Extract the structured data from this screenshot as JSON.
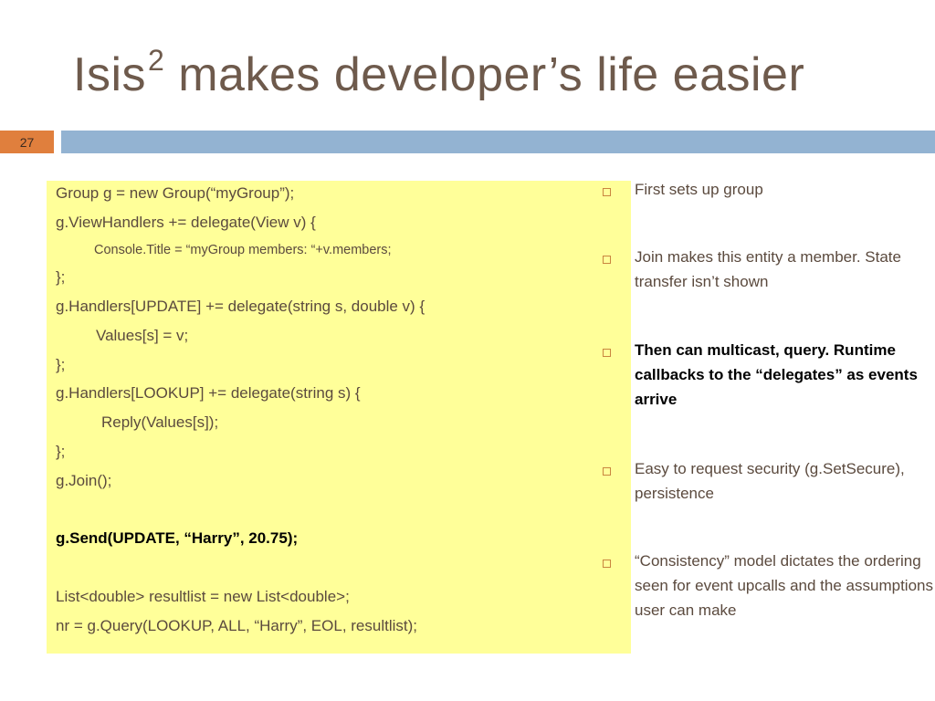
{
  "slide": {
    "title_main": "Isis",
    "title_sup": "2",
    "title_rest": " makes developer’s life easier",
    "number": "27"
  },
  "code_lines": [
    "Group g = new Group(“myGroup”);",
    "g.ViewHandlers += delegate(View v) {",
    "Console.Title = “myGroup members: “+v.members;",
    "};",
    "g.Handlers[UPDATE] += delegate(string s, double v) {",
    "Values[s] = v;",
    "};",
    "g.Handlers[LOOKUP] += delegate(string s) {",
    "Reply(Values[s]);",
    "};",
    "g.Join();",
    "g.Send(UPDATE, “Harry”, 20.75);",
    "List<double> resultlist = new List<double>;",
    "nr = g.Query(LOOKUP, ALL, “Harry”, EOL, resultlist);"
  ],
  "bullets": [
    "First sets up group",
    "Join makes this entity a member. State transfer isn’t shown",
    "Then can multicast, query. Runtime callbacks to the “delegates” as events arrive",
    "Easy to request security (g.SetSecure), persistence",
    "“Consistency” model dictates the ordering seen for event upcalls and the assumptions user can make"
  ],
  "colors": {
    "title": "#6e5a4c",
    "slide_number_bg": "#e07f3d",
    "rule_bar": "#93b3d2",
    "code_bg": "#ffff99",
    "bullet_marker": "#c9853f"
  }
}
